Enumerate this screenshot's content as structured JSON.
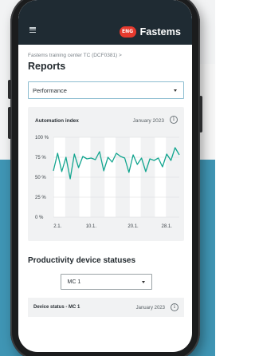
{
  "app": {
    "brand_logo": "ENG",
    "brand_name": "Fastems",
    "accent_color": "#e63a2e",
    "appbar_color": "#1f2b33"
  },
  "breadcrumb": "Fastems training center TC (DCF0381)  >",
  "page_title": "Reports",
  "report_select": {
    "value": "Performance"
  },
  "automation_card": {
    "title": "Automation index",
    "date": "January 2023",
    "info_icon": "i"
  },
  "chart_data": {
    "type": "line",
    "title": "Automation index",
    "x_tick_labels": [
      "2.1.",
      "10.1.",
      "20.1.",
      "28.1."
    ],
    "y_tick_labels": [
      "100 %",
      "75 %",
      "50 %",
      "25 %",
      "0 %"
    ],
    "ylim": [
      0,
      100
    ],
    "x": [
      1,
      2,
      3,
      4,
      5,
      6,
      7,
      8,
      9,
      10,
      11,
      12,
      13,
      14,
      15,
      16,
      17,
      18,
      19,
      20,
      21,
      22,
      23,
      24,
      25,
      26,
      27,
      28,
      29,
      30,
      31
    ],
    "series": [
      {
        "values": [
          58,
          80,
          57,
          75,
          48,
          79,
          62,
          76,
          73,
          74,
          72,
          82,
          58,
          75,
          69,
          80,
          76,
          74,
          56,
          78,
          66,
          74,
          57,
          73,
          71,
          74,
          63,
          79,
          71,
          87,
          78
        ],
        "color": "#12a58f"
      }
    ],
    "grid": true,
    "striped_columns": true
  },
  "productivity": {
    "title": "Productivity device statuses",
    "device_select": {
      "value": "MC 1"
    },
    "status_title": "Device status - MC 1",
    "status_date": "January 2023",
    "info_icon": "i"
  }
}
